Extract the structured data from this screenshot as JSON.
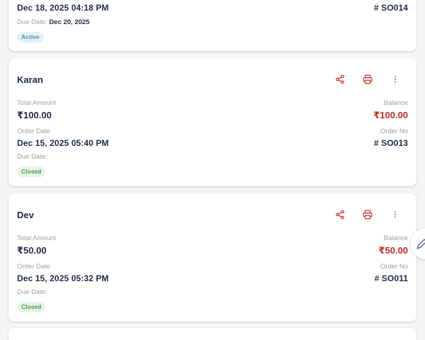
{
  "colors": {
    "balance_red": "#c62828",
    "icon_red": "#c62828",
    "text_dark": "#1f2a44",
    "label_gray": "#9aa0a8"
  },
  "cards": [
    {
      "order_date": "Dec 18, 2025 04:18 PM",
      "order_no": "# SO014",
      "due_label": "Due Date:",
      "due_value": "Dec 20, 2025",
      "status": "Active"
    },
    {
      "customer": "Karan",
      "total_label": "Total Amount",
      "total": "₹100.00",
      "balance_label": "Balance",
      "balance": "₹100.00",
      "order_date_label": "Order Date",
      "order_date": "Dec 15, 2025 05:40 PM",
      "order_no_label": "Order No",
      "order_no": "# SO013",
      "due_label": "Due Date:",
      "status": "Closed"
    },
    {
      "customer": "Dev",
      "total_label": "Total Amount",
      "total": "₹50.00",
      "balance_label": "Balance",
      "balance": "₹50.00",
      "order_date_label": "Order Date",
      "order_date": "Dec 15, 2025 05:32 PM",
      "order_no_label": "Order No",
      "order_no": "# SO011",
      "due_label": "Due Date:",
      "status": "Closed"
    }
  ],
  "icons": {
    "share": "share-icon",
    "print": "printer-icon",
    "more": "more-vertical-icon",
    "fab": "edit-pencil-icon"
  }
}
